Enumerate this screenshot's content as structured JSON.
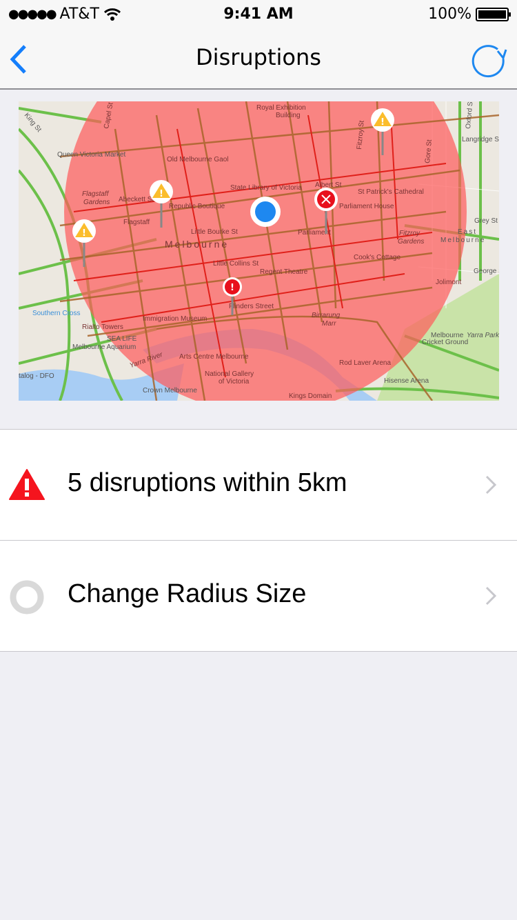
{
  "status_bar": {
    "carrier": "AT&T",
    "time": "9:41 AM",
    "battery": "100%"
  },
  "nav": {
    "title": "Disruptions",
    "back_icon": "chevron-left-icon",
    "refresh_icon": "refresh-icon"
  },
  "map": {
    "labels": {
      "royal_exhibition_1": "Royal Exhibition",
      "royal_exhibition_2": "Building",
      "queen_victoria_market": "Queen Victoria Market",
      "old_melbourne_gaol": "Old Melbourne Gaol",
      "state_library": "State Library of Victoria",
      "flagstaff_gardens_1": "Flagstaff",
      "flagstaff_gardens_2": "Gardens",
      "abeckett_st": "Abeckett St",
      "republic_boutique": "Republic Boutique",
      "flagstaff": "Flagstaff",
      "melbourne": "Melbourne",
      "little_bourke_st": "Little Bourke St",
      "little_collins_st": "Little Collins St",
      "st_patricks": "St Patrick's Cathedral",
      "parliament_house": "Parliament House",
      "parliament": "Parliament",
      "albert_st": "Albert St",
      "cooks_cottage": "Cook's Cottage",
      "fitzroy_gardens_1": "Fitzroy",
      "fitzroy_gardens_2": "Gardens",
      "east_melbourne_1": "East",
      "east_melbourne_2": "Melbourne",
      "regent_theatre": "Regent Theatre",
      "southern_cross": "Southern Cross",
      "rialto_towers": "Rialto Towers",
      "sea_life": "SEA LIFE",
      "melbourne_aquarium": "Melbourne Aquarium",
      "immigration_museum": "Immigration Museum",
      "yarra_river": "Yarra River",
      "arts_centre": "Arts Centre Melbourne",
      "national_gallery_1": "National Gallery",
      "national_gallery_2": "of Victoria",
      "crown_melbourne": "Crown Melbourne",
      "birrarung_1": "Birrarung",
      "birrarung_2": "Marr",
      "rod_laver": "Rod Laver Arena",
      "mcg_1": "Melbourne",
      "mcg_2": "Cricket Ground",
      "yarra_park": "Yarra Park",
      "hisense_arena": "Hisense Arena",
      "george_st": "George St",
      "grey_st": "Grey St",
      "oxford_st": "Oxford St",
      "langridge_st": "Langridge St",
      "gore_st": "Gore St",
      "fitzroy_st": "Fitzroy St",
      "king_st": "King St",
      "capel_st": "Capel St",
      "jolimont": "Jolimont",
      "kings_domain": "Kings Domain",
      "flinders_street": "Flinders Street",
      "outlet": "talog - DFO"
    },
    "colors": {
      "radius": "#ff5a5a",
      "warning": "#fbbd2c",
      "error": "#e8101c",
      "user": "#1e88f0"
    }
  },
  "list": {
    "disruptions": {
      "label": "5 disruptions within 5km",
      "icon": "warning-triangle-icon",
      "color": "#f5141e"
    },
    "radius": {
      "label": "Change Radius Size",
      "icon": "circle-ring-icon"
    }
  }
}
